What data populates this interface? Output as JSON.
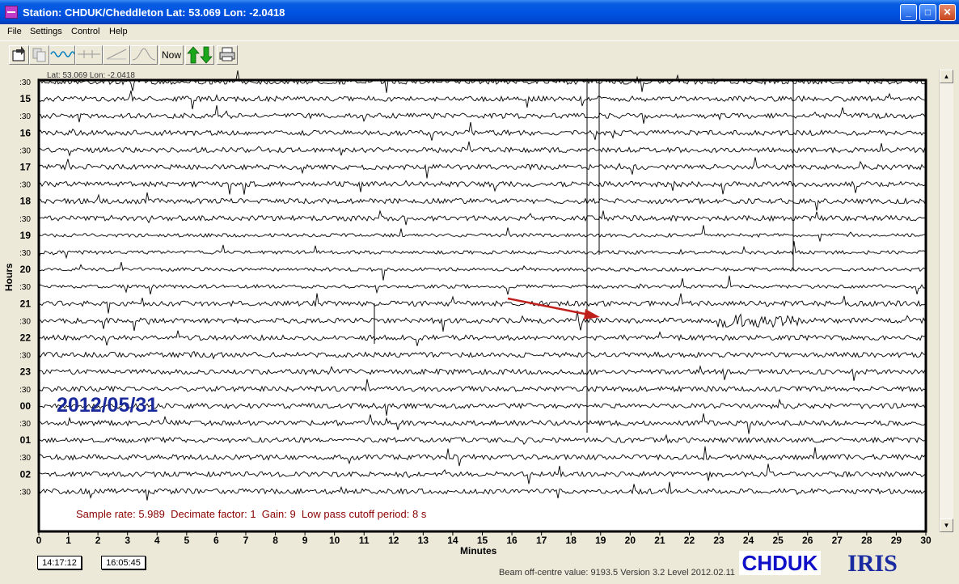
{
  "window": {
    "title": "Station: CHDUK/Cheddleton Lat: 53.069 Lon: -2.0418"
  },
  "menu": [
    "File",
    "Settings",
    "Control",
    "Help"
  ],
  "toolbar": {
    "now_label": "Now",
    "icons": [
      "open-file-icon",
      "copy-icon",
      "waveform-icon",
      "flat-trace-icon",
      "ramp-icon",
      "bell-curve-icon",
      "up-down-arrows-icon",
      "printer-icon"
    ]
  },
  "plot": {
    "header_coords": "Lat: 53.069 Lon: -2.0418",
    "date_label": "2012/05/31",
    "info_line": "Sample rate: 5.989  Decimate factor: 1  Gain: 9  Low pass cutoff period: 8 s",
    "row_labels": [
      ":30",
      "15",
      ":30",
      "16",
      ":30",
      "17",
      ":30",
      "18",
      ":30",
      "19",
      ":30",
      "20",
      ":30",
      "21",
      ":30",
      "22",
      ":30",
      "23",
      ":30",
      "00",
      ":30",
      "01",
      ":30",
      "02",
      ":30"
    ],
    "x_ticks": [
      "0",
      "1",
      "2",
      "3",
      "4",
      "5",
      "6",
      "7",
      "8",
      "9",
      "10",
      "11",
      "12",
      "13",
      "14",
      "15",
      "16",
      "17",
      "18",
      "19",
      "20",
      "21",
      "22",
      "23",
      "24",
      "25",
      "26",
      "27",
      "28",
      "29",
      "30"
    ],
    "x_axis_label": "Minutes",
    "y_axis_label": "Hours",
    "colors": {
      "trace": "#000000",
      "info_text": "#8b0000",
      "date_text": "#1a2a9a",
      "arrow": "#c0201c"
    }
  },
  "status": {
    "time_left": "14:17:12",
    "time_right": "16:05:45",
    "beam_text": "Beam off-centre value: 9193.5   Version 3.2 Level 2012.02.11"
  },
  "logos": {
    "station": "CHDUK",
    "iris": "IRIS"
  }
}
